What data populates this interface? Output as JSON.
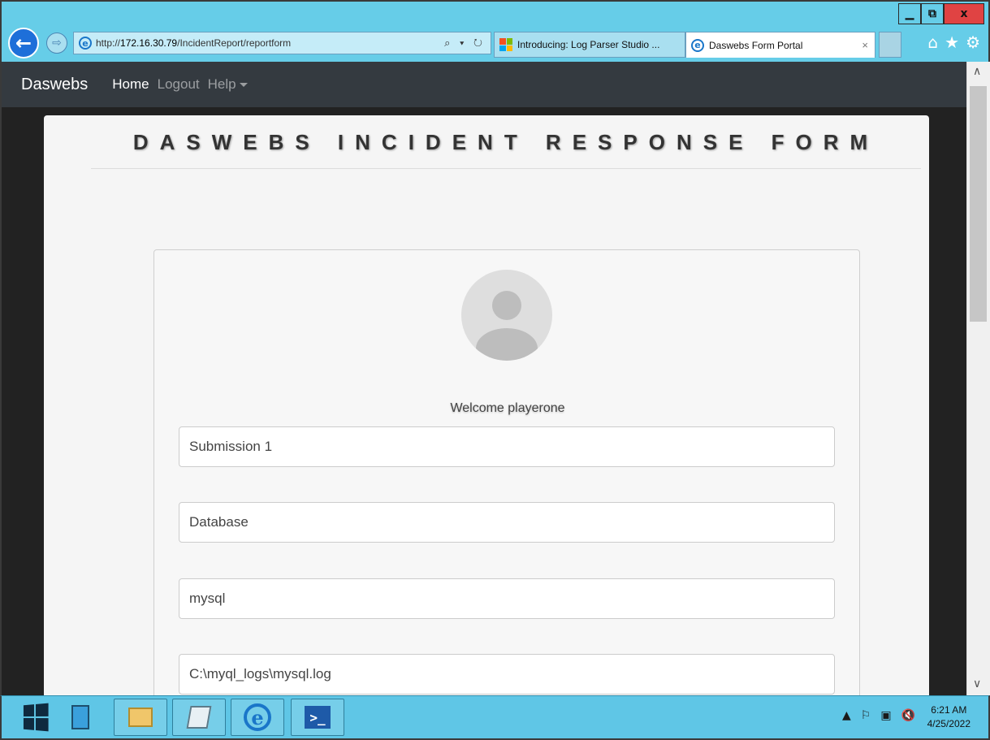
{
  "browser": {
    "address": {
      "prefix": "http://",
      "host": "172.16.30.79",
      "path": "/IncidentReport/reportform",
      "tools": "⌕ ▾ ↻"
    },
    "tabs": [
      {
        "label": "Introducing: Log Parser Studio ..."
      },
      {
        "label": "Daswebs Form Portal",
        "close": "×"
      }
    ],
    "window_buttons": {
      "minimize": "▁",
      "restore": "⧉",
      "close": "x"
    },
    "icons": {
      "back": "←",
      "forward": "⇨",
      "home": "⌂",
      "favorites": "★",
      "settings": "⚙"
    }
  },
  "site": {
    "brand": "Daswebs",
    "nav": [
      {
        "label": "Home",
        "active": true
      },
      {
        "label": "Logout",
        "active": false
      },
      {
        "label": "Help",
        "active": false
      }
    ]
  },
  "form": {
    "title": "DASWEBS INCIDENT RESPONSE FORM",
    "welcome": "Welcome playerone",
    "fields": [
      {
        "value": "Submission 1"
      },
      {
        "value": "Database"
      },
      {
        "value": "mysql"
      },
      {
        "value": "C:\\myql_logs\\mysql.log"
      }
    ]
  },
  "taskbar": {
    "tray_icons": [
      "▲",
      "⚐",
      "▣",
      "🔇"
    ],
    "time": "6:21 AM",
    "date": "4/25/2022"
  },
  "scrollbar": {
    "up": "∧",
    "down": "∨"
  },
  "colors": {
    "titlebar": "#66cde8",
    "navbar": "#343a40",
    "taskbar": "#5fc6e6",
    "close_button": "#e04343"
  }
}
